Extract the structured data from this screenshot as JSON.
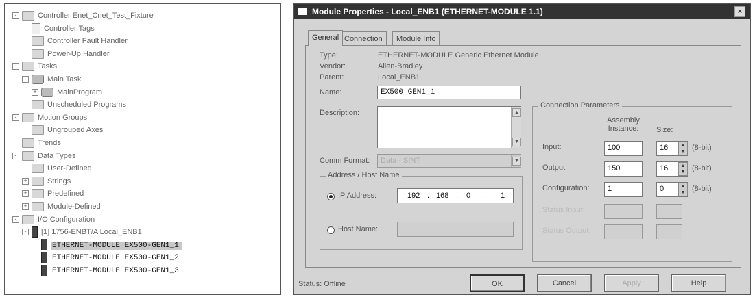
{
  "tree": {
    "items": [
      {
        "label": "Controller Enet_Cnet_Test_Fixture",
        "level": 0,
        "icon": "folder-icon",
        "toggle": "-"
      },
      {
        "label": "Controller Tags",
        "level": 1,
        "icon": "document-icon",
        "toggle": ""
      },
      {
        "label": "Controller Fault Handler",
        "level": 1,
        "icon": "folder-icon",
        "toggle": ""
      },
      {
        "label": "Power-Up Handler",
        "level": 1,
        "icon": "folder-icon",
        "toggle": ""
      },
      {
        "label": "Tasks",
        "level": 0,
        "icon": "folder-icon",
        "toggle": "-"
      },
      {
        "label": "Main Task",
        "level": 1,
        "icon": "gear-icon",
        "toggle": "-"
      },
      {
        "label": "MainProgram",
        "level": 2,
        "icon": "program-icon",
        "toggle": "+"
      },
      {
        "label": "Unscheduled Programs",
        "level": 1,
        "icon": "folder-icon",
        "toggle": ""
      },
      {
        "label": "Motion Groups",
        "level": 0,
        "icon": "folder-icon",
        "toggle": "-"
      },
      {
        "label": "Ungrouped Axes",
        "level": 1,
        "icon": "folder-icon",
        "toggle": ""
      },
      {
        "label": "Trends",
        "level": 0,
        "icon": "folder-icon",
        "toggle": ""
      },
      {
        "label": "Data Types",
        "level": 0,
        "icon": "folder-icon",
        "toggle": "-"
      },
      {
        "label": "User-Defined",
        "level": 1,
        "icon": "folder-icon",
        "toggle": ""
      },
      {
        "label": "Strings",
        "level": 1,
        "icon": "folder-icon",
        "toggle": "+"
      },
      {
        "label": "Predefined",
        "level": 1,
        "icon": "folder-icon",
        "toggle": "+"
      },
      {
        "label": "Module-Defined",
        "level": 1,
        "icon": "folder-icon",
        "toggle": "+"
      },
      {
        "label": "I/O Configuration",
        "level": 0,
        "icon": "folder-icon",
        "toggle": "-"
      },
      {
        "label": "[1] 1756-ENBT/A Local_ENB1",
        "level": 1,
        "icon": "module-icon",
        "toggle": "-"
      },
      {
        "label": "ETHERNET-MODULE EX500-GEN1_1",
        "level": 2,
        "icon": "module-icon",
        "toggle": "",
        "selected": true
      },
      {
        "label": "ETHERNET-MODULE EX500-GEN1_2",
        "level": 2,
        "icon": "module-icon",
        "toggle": ""
      },
      {
        "label": "ETHERNET-MODULE EX500-GEN1_3",
        "level": 2,
        "icon": "module-icon",
        "toggle": ""
      }
    ]
  },
  "dialog": {
    "title": "Module Properties - Local_ENB1 (ETHERNET-MODULE 1.1)",
    "close": "×",
    "tabs": [
      "General",
      "Connection",
      "Module Info"
    ],
    "type_label": "Type:",
    "type_value": "ETHERNET-MODULE Generic Ethernet Module",
    "vendor_label": "Vendor:",
    "vendor_value": "Allen-Bradley",
    "parent_label": "Parent:",
    "parent_value": "Local_ENB1",
    "name_label": "Name:",
    "name_value": "EX500_GEN1_1",
    "description_label": "Description:",
    "description_value": "",
    "comm_format_label": "Comm Format:",
    "comm_format_value": "Data - SINT",
    "address_group_title": "Address / Host Name",
    "ip_label": "IP Address:",
    "ip": [
      "192",
      "168",
      "0",
      "1"
    ],
    "host_label": "Host Name:",
    "host_value": "",
    "conn_group_title": "Connection Parameters",
    "col_assembly": "Assembly Instance:",
    "col_size": "Size:",
    "rows": [
      {
        "label": "Input:",
        "instance": "100",
        "size": "16",
        "unit": "(8-bit)"
      },
      {
        "label": "Output:",
        "instance": "150",
        "size": "16",
        "unit": "(8-bit)"
      },
      {
        "label": "Configuration:",
        "instance": "1",
        "size": "0",
        "unit": "(8-bit)"
      },
      {
        "label": "Status Input:",
        "instance": "",
        "size": "",
        "unit": ""
      },
      {
        "label": "Status Output:",
        "instance": "",
        "size": "",
        "unit": ""
      }
    ],
    "status": "Status: Offline",
    "buttons": {
      "ok": "OK",
      "cancel": "Cancel",
      "apply": "Apply",
      "help": "Help"
    }
  }
}
